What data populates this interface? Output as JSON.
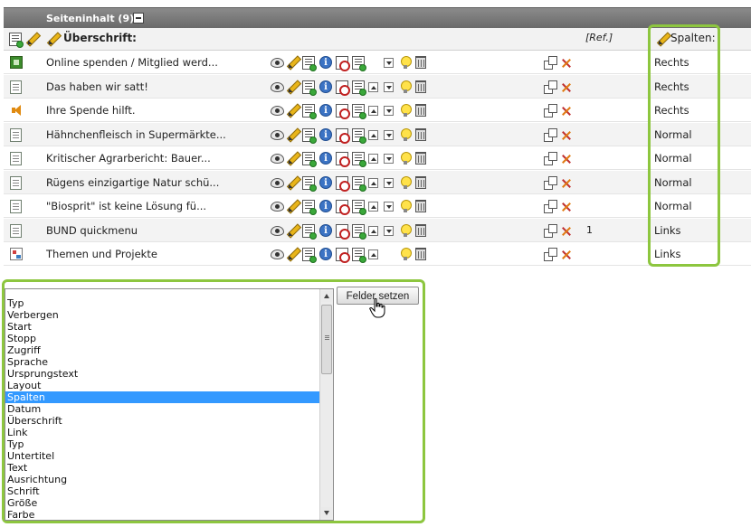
{
  "header": {
    "title": "Seiteninhalt (9)"
  },
  "column_header": {
    "title": "Überschrift:",
    "ref": "[Ref.]",
    "columns": "Spalten:"
  },
  "rows": [
    {
      "title": "Online spenden / Mitglied werd...",
      "column": "Rechts",
      "ref": "",
      "icon": "image-content-icon"
    },
    {
      "title": "Das haben wir satt!",
      "column": "Rechts",
      "ref": "",
      "icon": "text-content-icon"
    },
    {
      "title": "Ihre Spende hilft.",
      "column": "Rechts",
      "ref": "",
      "icon": "audio-content-icon"
    },
    {
      "title": "Hähnchenfleisch in Supermärkte...",
      "column": "Normal",
      "ref": "",
      "icon": "text-content-icon"
    },
    {
      "title": "Kritischer Agrarbericht: Bauer...",
      "column": "Normal",
      "ref": "",
      "icon": "text-content-icon"
    },
    {
      "title": "Rügens einzigartige Natur schü...",
      "column": "Normal",
      "ref": "",
      "icon": "text-content-icon"
    },
    {
      "title": "\"Biosprit\" ist keine Lösung fü...",
      "column": "Normal",
      "ref": "",
      "icon": "text-content-icon"
    },
    {
      "title": "BUND quickmenu",
      "column": "Links",
      "ref": "1",
      "icon": "text-content-icon"
    },
    {
      "title": "Themen und Projekte",
      "column": "Links",
      "ref": "",
      "icon": "menu-content-icon"
    }
  ],
  "field_list": {
    "items": [
      "Typ",
      "Verbergen",
      "Start",
      "Stopp",
      "Zugriff",
      "Sprache",
      "Ursprungstext",
      "Layout",
      "Spalten",
      "Datum",
      "Überschrift",
      "Link",
      "Typ",
      "Untertitel",
      "Text",
      "Ausrichtung",
      "Schrift",
      "Größe",
      "Farbe"
    ],
    "selected": "Spalten"
  },
  "set_fields_button": {
    "label": "Felder setzen"
  },
  "colors": {
    "highlight": "#8dc63f",
    "selection": "#3399ff",
    "header_bg": "#7a7a7a"
  }
}
